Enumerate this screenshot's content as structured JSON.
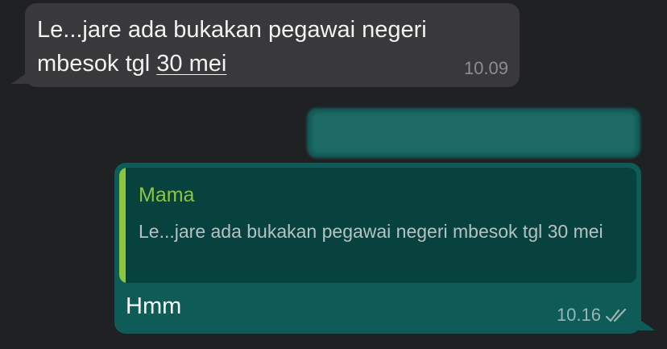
{
  "messages": {
    "incoming": {
      "text_before_link": "Le...jare ada bukakan pegawai negeri mbesok tgl ",
      "link_text": "30 mei",
      "time": "10.09"
    },
    "outgoing": {
      "quote": {
        "author": "Mama",
        "text": "Le...jare ada bukakan pegawai negeri mbesok tgl 30 mei"
      },
      "text": "Hmm",
      "time": "10.16",
      "status_icon": "double-check-icon"
    }
  },
  "colors": {
    "background": "#1f2123",
    "incoming_bubble": "#39393b",
    "outgoing_bubble": "#0d5c58",
    "quote_bar": "#8cc63f"
  }
}
